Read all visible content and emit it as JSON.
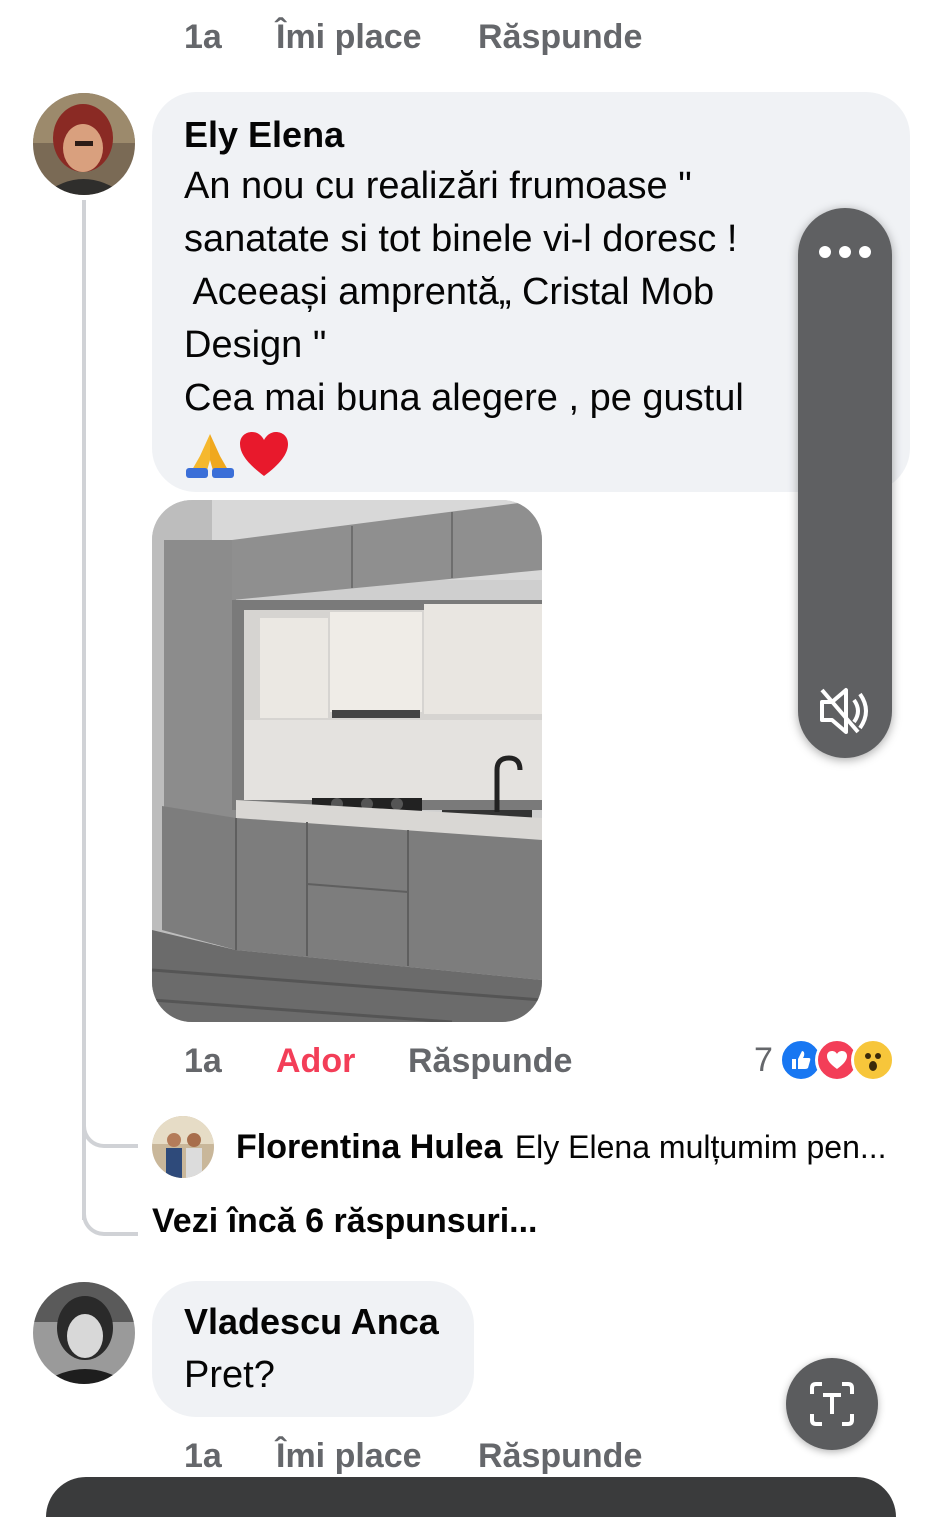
{
  "top_comment_actions": {
    "time": "1a",
    "like": "Îmi place",
    "reply": "Răspunde"
  },
  "comment_main": {
    "author": "Ely Elena",
    "lines": [
      "An nou cu realizări frumoase \"",
      "sanatate si tot binele vi-l doresc !",
      " Aceeași amprentă„ Cristal Mob",
      "Design \"",
      "Cea mai buna alegere , pe gustul "
    ],
    "emojis": [
      "folded-hands-emoji",
      "red-heart-emoji"
    ],
    "image_alt": "kitchen-photo",
    "actions": {
      "time": "1a",
      "reaction_label": "Ador",
      "reply": "Răspunde"
    },
    "reactions": {
      "count": "7",
      "types": [
        "like",
        "love",
        "wow"
      ]
    }
  },
  "reply_preview": {
    "author": "Florentina Hulea",
    "text": "Ely Elena mulțumim pen..."
  },
  "more_replies": "Vezi încă 6 răspunsuri...",
  "comment_second": {
    "author": "Vladescu Anca",
    "text": "Pret?",
    "actions": {
      "time": "1a",
      "like": "Îmi place",
      "reply": "Răspunde"
    }
  },
  "video_overlay": {
    "menu_icon": "more-dots-icon",
    "mute_icon": "muted-speaker-icon"
  },
  "fab": {
    "icon": "text-recognize-icon"
  },
  "colors": {
    "love": "#f33e58",
    "like_blue": "#1877f2",
    "bubble": "#f0f2f5",
    "meta": "#65676b"
  }
}
